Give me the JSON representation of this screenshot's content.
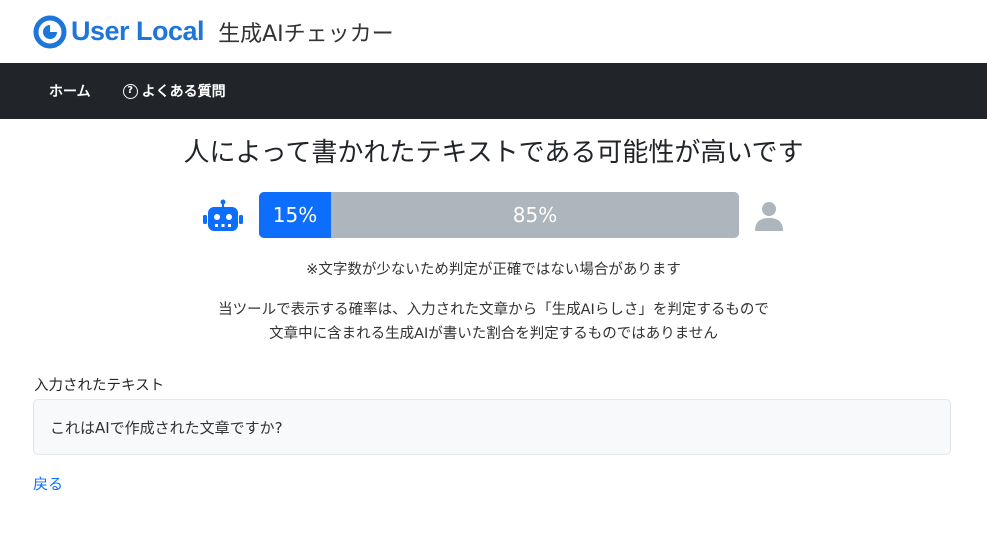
{
  "header": {
    "logo_text": "User Local",
    "app_title": "生成AIチェッカー",
    "brand_color": "#1e77d8"
  },
  "nav": {
    "home_label": "ホーム",
    "faq_label": "よくある質問",
    "faq_icon": "question-circle-icon"
  },
  "result": {
    "title": "人によって書かれたテキストである可能性が高いです",
    "ai_percent": 15,
    "ai_label": "15%",
    "human_percent": 85,
    "human_label": "85%",
    "ai_color": "#0d6efd",
    "human_color": "#adb5bd",
    "ai_icon": "robot-icon",
    "human_icon": "person-icon"
  },
  "note": "※文字数が少ないため判定が正確ではない場合があります",
  "disclaimer": {
    "line1": "当ツールで表示する確率は、入力された文章から「生成AIらしさ」を判定するもので",
    "line2": "文章中に含まれる生成AIが書いた割合を判定するものではありません"
  },
  "input_section": {
    "label": "入力されたテキスト",
    "value": "これはAIで作成された文章ですか?"
  },
  "back_link": "戻る"
}
